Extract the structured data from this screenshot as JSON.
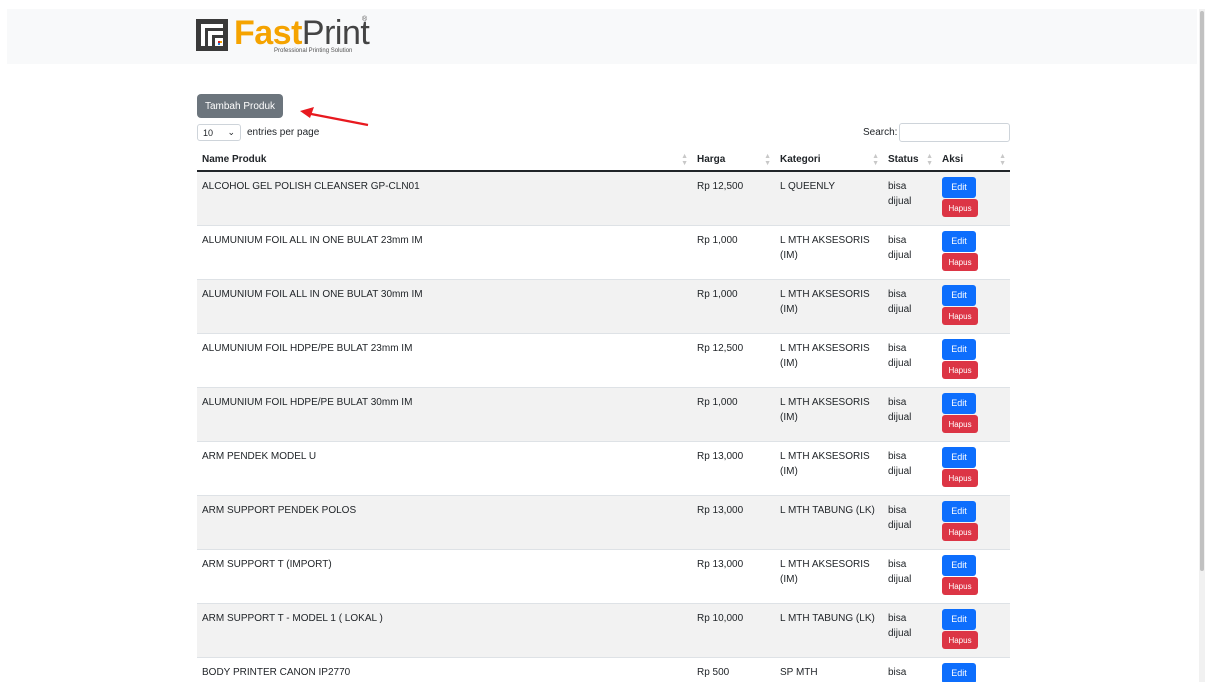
{
  "brand": {
    "fast": "Fast",
    "print": "Print",
    "reg": "®",
    "tagline": "Professional Printing Solution"
  },
  "toolbar": {
    "add_label": "Tambah Produk"
  },
  "length_menu": {
    "value": "10",
    "label": "entries per page"
  },
  "search": {
    "label": "Search:",
    "value": ""
  },
  "table": {
    "headers": [
      "Name Produk",
      "Harga",
      "Kategori",
      "Status",
      "Aksi"
    ],
    "edit_label": "Edit",
    "delete_label": "Hapus",
    "rows": [
      {
        "name": "ALCOHOL GEL POLISH CLEANSER GP-CLN01",
        "price": "Rp 12,500",
        "category": "L QUEENLY",
        "status": "bisa dijual"
      },
      {
        "name": "ALUMUNIUM FOIL ALL IN ONE BULAT 23mm IM",
        "price": "Rp 1,000",
        "category": "L MTH AKSESORIS (IM)",
        "status": "bisa dijual"
      },
      {
        "name": "ALUMUNIUM FOIL ALL IN ONE BULAT 30mm IM",
        "price": "Rp 1,000",
        "category": "L MTH AKSESORIS (IM)",
        "status": "bisa dijual"
      },
      {
        "name": "ALUMUNIUM FOIL HDPE/PE BULAT 23mm IM",
        "price": "Rp 12,500",
        "category": "L MTH AKSESORIS (IM)",
        "status": "bisa dijual"
      },
      {
        "name": "ALUMUNIUM FOIL HDPE/PE BULAT 30mm IM",
        "price": "Rp 1,000",
        "category": "L MTH AKSESORIS (IM)",
        "status": "bisa dijual"
      },
      {
        "name": "ARM PENDEK MODEL U",
        "price": "Rp 13,000",
        "category": "L MTH AKSESORIS (IM)",
        "status": "bisa dijual"
      },
      {
        "name": "ARM SUPPORT PENDEK POLOS",
        "price": "Rp 13,000",
        "category": "L MTH TABUNG (LK)",
        "status": "bisa dijual"
      },
      {
        "name": "ARM SUPPORT T (IMPORT)",
        "price": "Rp 13,000",
        "category": "L MTH AKSESORIS (IM)",
        "status": "bisa dijual"
      },
      {
        "name": "ARM SUPPORT T - MODEL 1 ( LOKAL )",
        "price": "Rp 10,000",
        "category": "L MTH TABUNG (LK)",
        "status": "bisa dijual"
      },
      {
        "name": "BODY PRINTER CANON IP2770",
        "price": "Rp 500",
        "category": "SP MTH SPAREPART",
        "status": "bisa"
      }
    ]
  },
  "colors": {
    "add_button": "#6c757d",
    "edit_button": "#0d6efd",
    "delete_button": "#dc3545",
    "annotation_arrow": "#e8191f"
  }
}
